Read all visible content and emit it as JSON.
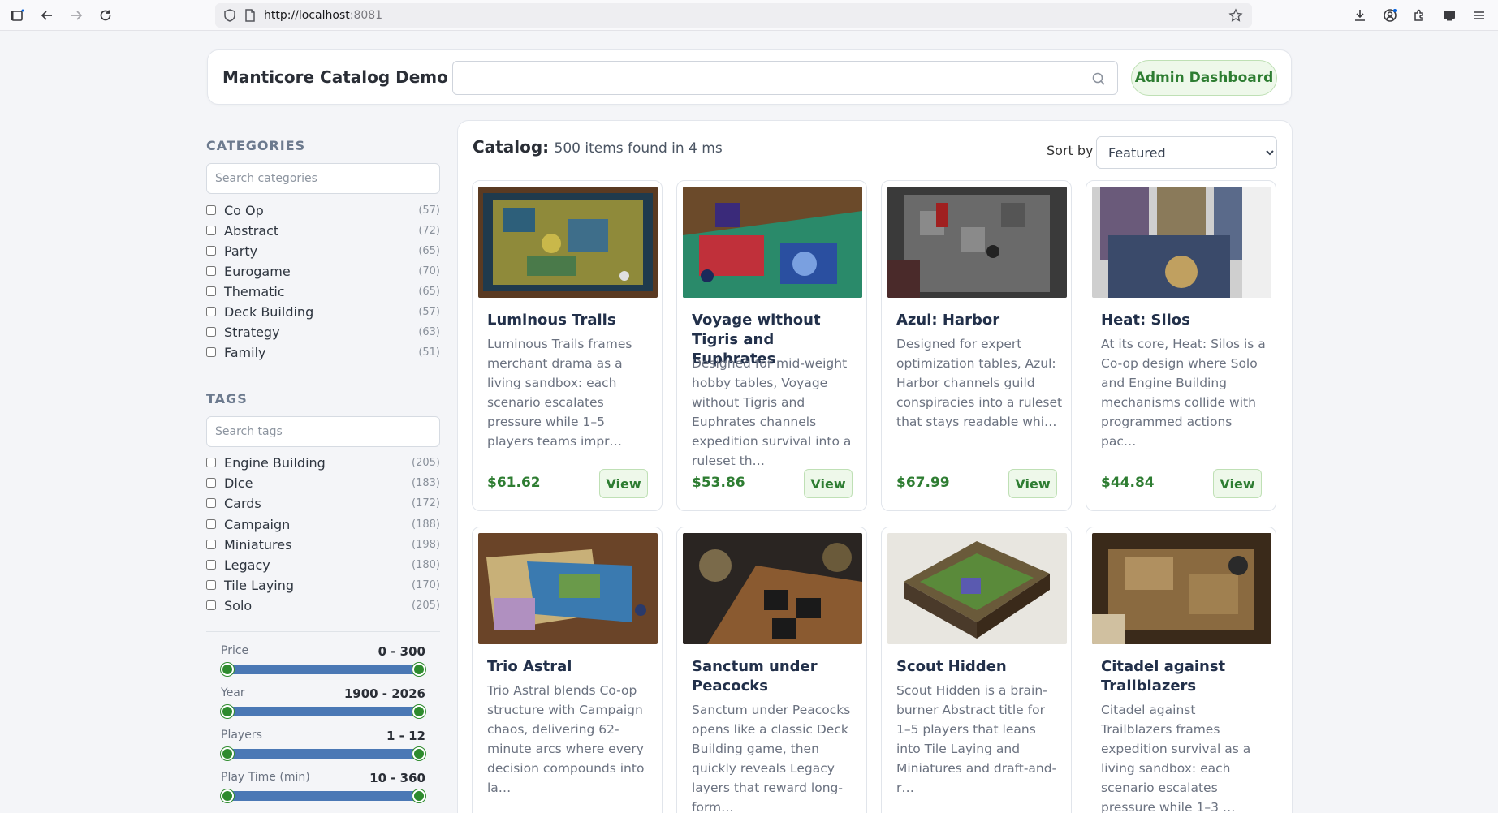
{
  "browser": {
    "url_host": "http://localhost",
    "url_port": ":8081"
  },
  "header": {
    "title": "Manticore Catalog Demo",
    "search_placeholder": "",
    "admin_button": "Admin Dashboard"
  },
  "sidebar": {
    "categories_heading": "CATEGORIES",
    "categories_placeholder": "Search categories",
    "categories": [
      {
        "label": "Co Op",
        "count": "(57)"
      },
      {
        "label": "Abstract",
        "count": "(72)"
      },
      {
        "label": "Party",
        "count": "(65)"
      },
      {
        "label": "Eurogame",
        "count": "(70)"
      },
      {
        "label": "Thematic",
        "count": "(65)"
      },
      {
        "label": "Deck Building",
        "count": "(57)"
      },
      {
        "label": "Strategy",
        "count": "(63)"
      },
      {
        "label": "Family",
        "count": "(51)"
      }
    ],
    "tags_heading": "TAGS",
    "tags_placeholder": "Search tags",
    "tags": [
      {
        "label": "Engine Building",
        "count": "(205)"
      },
      {
        "label": "Dice",
        "count": "(183)"
      },
      {
        "label": "Cards",
        "count": "(172)"
      },
      {
        "label": "Campaign",
        "count": "(188)"
      },
      {
        "label": "Miniatures",
        "count": "(198)"
      },
      {
        "label": "Legacy",
        "count": "(180)"
      },
      {
        "label": "Tile Laying",
        "count": "(170)"
      },
      {
        "label": "Solo",
        "count": "(205)"
      }
    ],
    "ranges": [
      {
        "label": "Price",
        "value": "0 - 300"
      },
      {
        "label": "Year",
        "value": "1900 - 2026"
      },
      {
        "label": "Players",
        "value": "1 - 12"
      },
      {
        "label": "Play Time (min)",
        "value": "10 - 360"
      }
    ]
  },
  "main": {
    "catalog_label": "Catalog:",
    "results_text": "500 items found in 4 ms",
    "sort_label": "Sort by",
    "sort_value": "Featured",
    "view_label": "View",
    "products": [
      {
        "title": "Luminous Trails",
        "desc": "Luminous Trails frames merchant drama as a living sandbox: each scenario escalates pressure while 1–5 players teams impr…",
        "price": "$61.62"
      },
      {
        "title": "Voyage without Tigris and Euphrates",
        "desc": "Designed for mid-weight hobby tables, Voyage without Tigris and Euphrates channels expedition survival into a ruleset th…",
        "price": "$53.86"
      },
      {
        "title": "Azul: Harbor",
        "desc": "Designed for expert optimization tables, Azul: Harbor channels guild conspiracies into a ruleset that stays readable whi…",
        "price": "$67.99"
      },
      {
        "title": "Heat: Silos",
        "desc": "At its core, Heat: Silos is a Co-op design where Solo and Engine Building mechanisms collide with programmed actions pac…",
        "price": "$44.84"
      },
      {
        "title": "Trio Astral",
        "desc": "Trio Astral blends Co-op structure with Campaign chaos, delivering 62-minute arcs where every decision compounds into la…",
        "price": ""
      },
      {
        "title": "Sanctum under Peacocks",
        "desc": "Sanctum under Peacocks opens like a classic Deck Building game, then quickly reveals Legacy layers that reward long-form…",
        "price": ""
      },
      {
        "title": "Scout Hidden",
        "desc": "Scout Hidden is a brain-burner Abstract title for 1–5 players that leans into Tile Laying and Miniatures and draft-and-r…",
        "price": ""
      },
      {
        "title": "Citadel against Trailblazers",
        "desc": "Citadel against Trailblazers frames expedition survival as a living sandbox: each scenario escalates pressure while 1–3 …",
        "price": ""
      }
    ]
  }
}
